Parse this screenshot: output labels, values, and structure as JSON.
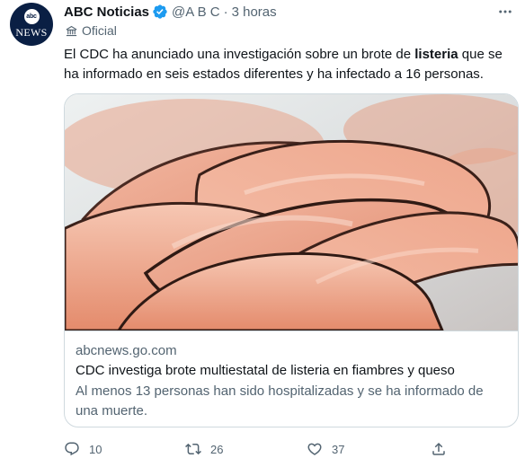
{
  "author": {
    "display_name": "ABC Noticias",
    "handle": "@A B C",
    "separator": "·",
    "time": "3 horas",
    "label": "Oficial",
    "avatar_top": "abc",
    "avatar_bottom": "NEWS"
  },
  "tweet": {
    "text_before": "El CDC ha anunciado una investigación sobre un brote de ",
    "text_bold": "listeria",
    "text_after": " que se ha informado en seis estados diferentes y ha infectado a 16 personas."
  },
  "card": {
    "domain": "abcnews.go.com",
    "title": "CDC investiga brote multiestatal de listeria en fiambres y queso",
    "description": "Al menos 13 personas han sido hospitalizadas y se ha informado de una muerte."
  },
  "actions": {
    "reply_count": "10",
    "retweet_count": "26",
    "like_count": "37"
  },
  "colors": {
    "text_primary": "#0f1419",
    "text_secondary": "#536471",
    "verified_blue": "#1d9bf0",
    "border": "#cfd9de",
    "avatar_bg": "#0a1f44"
  },
  "icons": {
    "verified": "verified-badge-icon",
    "official": "government-building-icon",
    "more": "more-dots-icon",
    "reply": "reply-icon",
    "retweet": "retweet-icon",
    "like": "heart-icon",
    "share": "share-icon"
  }
}
